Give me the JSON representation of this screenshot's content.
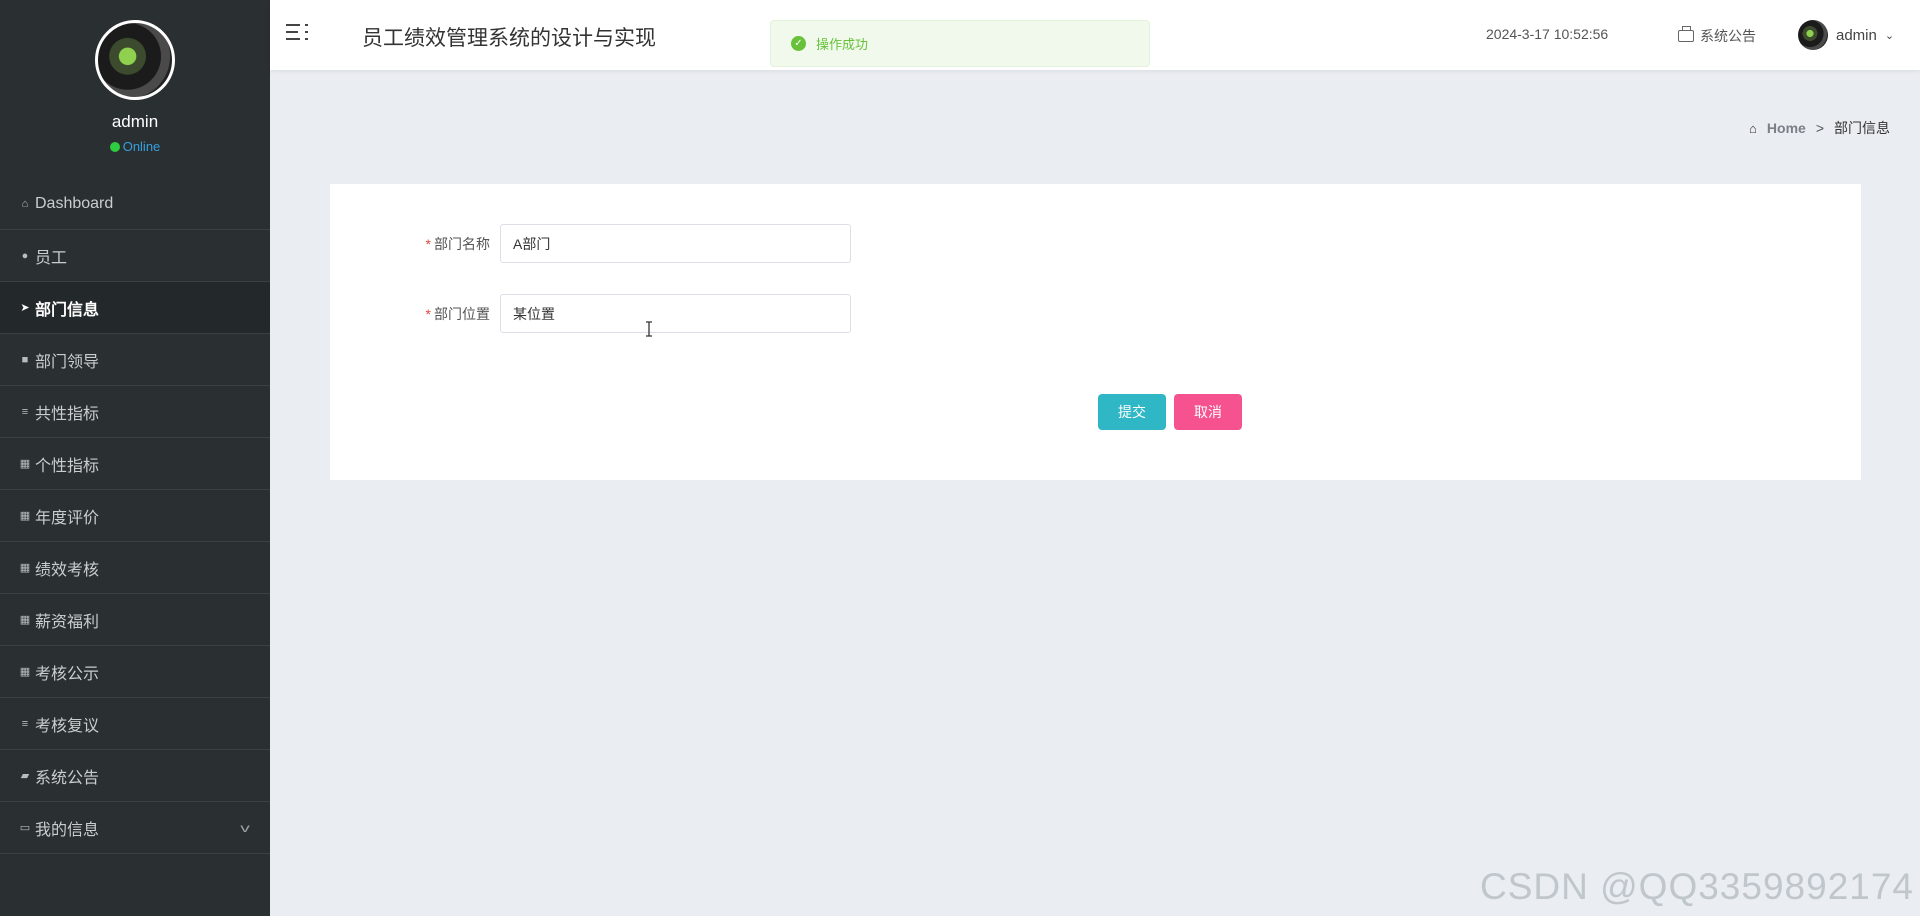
{
  "sidebar": {
    "user_name": "admin",
    "status": "Online",
    "items": [
      {
        "label": "Dashboard",
        "icon": "home-icon"
      },
      {
        "label": "员工",
        "icon": "pin-icon"
      },
      {
        "label": "部门信息",
        "icon": "send-icon",
        "active": true
      },
      {
        "label": "部门领导",
        "icon": "chat-icon"
      },
      {
        "label": "共性指标",
        "icon": "list-icon"
      },
      {
        "label": "个性指标",
        "icon": "grid-icon"
      },
      {
        "label": "年度评价",
        "icon": "grid-icon"
      },
      {
        "label": "绩效考核",
        "icon": "grid-icon"
      },
      {
        "label": "薪资福利",
        "icon": "grid-icon"
      },
      {
        "label": "考核公示",
        "icon": "grid-icon"
      },
      {
        "label": "考核复议",
        "icon": "list-icon"
      },
      {
        "label": "系统公告",
        "icon": "ticket-icon"
      },
      {
        "label": "我的信息",
        "icon": "card-icon",
        "expandable": true
      }
    ]
  },
  "header": {
    "title": "员工绩效管理系统的设计与实现",
    "datetime": "2024-3-17 10:52:56",
    "notice_label": "系统公告",
    "user_name": "admin"
  },
  "toast": {
    "message": "操作成功",
    "status_color": "#67c23a"
  },
  "breadcrumb": {
    "home": "Home",
    "separator": ">",
    "current": "部门信息"
  },
  "form": {
    "fields": [
      {
        "label": "部门名称",
        "value": "A部门",
        "required": true
      },
      {
        "label": "部门位置",
        "value": "某位置",
        "required": true
      }
    ],
    "submit_label": "提交",
    "cancel_label": "取消"
  },
  "colors": {
    "sidebar_bg": "#2a2f32",
    "submit": "#2fb7c5",
    "cancel": "#f5528f",
    "online": "#2ecc40"
  },
  "watermark": "CSDN @QQ3359892174"
}
